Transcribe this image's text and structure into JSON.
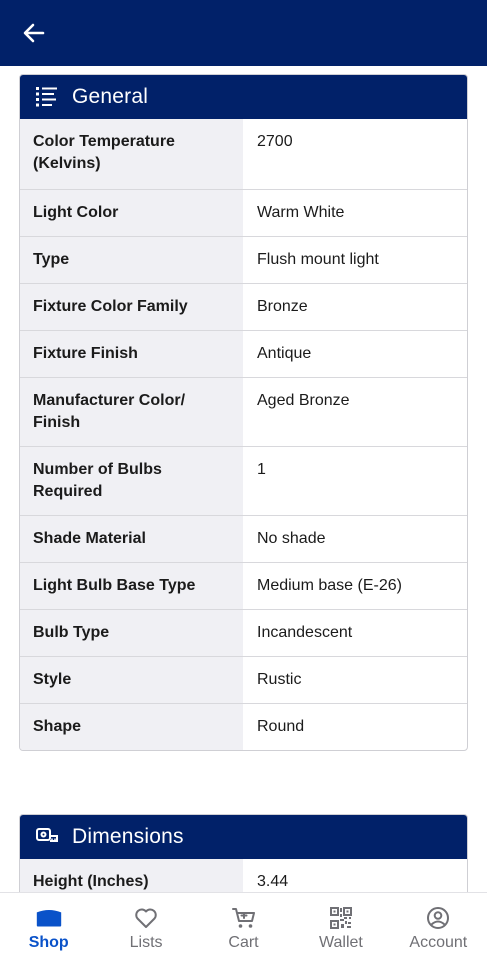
{
  "header": {
    "back_icon": "arrow-left-icon"
  },
  "general": {
    "title": "General",
    "icon": "list-icon",
    "rows": [
      {
        "label": "Color Temperature (Kelvins)",
        "value": "2700"
      },
      {
        "label": "Light Color",
        "value": "Warm White"
      },
      {
        "label": "Type",
        "value": "Flush mount light"
      },
      {
        "label": "Fixture Color Family",
        "value": "Bronze"
      },
      {
        "label": "Fixture Finish",
        "value": "Antique"
      },
      {
        "label": "Manufacturer Color/ Finish",
        "value": "Aged Bronze"
      },
      {
        "label": "Number of Bulbs Required",
        "value": "1"
      },
      {
        "label": "Shade Material",
        "value": "No shade"
      },
      {
        "label": "Light Bulb Base Type",
        "value": "Medium base (E-26)"
      },
      {
        "label": "Bulb Type",
        "value": "Incandescent"
      },
      {
        "label": "Style",
        "value": "Rustic"
      },
      {
        "label": "Shape",
        "value": "Round"
      }
    ]
  },
  "dimensions": {
    "title": "Dimensions",
    "icon": "tape-measure-icon",
    "rows": [
      {
        "label": "Height (Inches)",
        "value": "3.44"
      }
    ]
  },
  "nav": {
    "items": [
      {
        "label": "Shop",
        "icon": "store-icon",
        "active": true
      },
      {
        "label": "Lists",
        "icon": "heart-icon",
        "active": false
      },
      {
        "label": "Cart",
        "icon": "cart-icon",
        "active": false
      },
      {
        "label": "Wallet",
        "icon": "qr-code-icon",
        "active": false
      },
      {
        "label": "Account",
        "icon": "account-icon",
        "active": false
      }
    ]
  },
  "colors": {
    "brand_navy": "#012169",
    "active_blue": "#0a52c9",
    "label_bg": "#f0f0f4"
  }
}
